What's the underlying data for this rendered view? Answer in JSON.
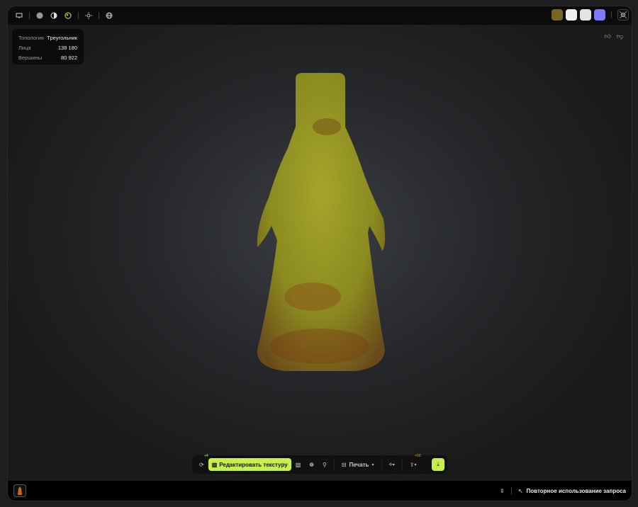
{
  "stats": {
    "topology_label": "Топология",
    "topology_value": "Треугольник",
    "faces_label": "Лица",
    "faces_value": "138 180",
    "vertices_label": "Вершины",
    "vertices_value": "80 922"
  },
  "swatches": [
    "#7a6420",
    "#eeeeee",
    "#e4e4e4",
    "#7b7bff"
  ],
  "toolbar": {
    "retry_badge": "+4",
    "edit_texture_label": "Редактировать текстуру",
    "print_label": "Печать",
    "export_badge": "+50"
  },
  "bottom": {
    "reuse_label": "Повторное использование запроса"
  },
  "colors": {
    "accent": "#c8f04b"
  }
}
